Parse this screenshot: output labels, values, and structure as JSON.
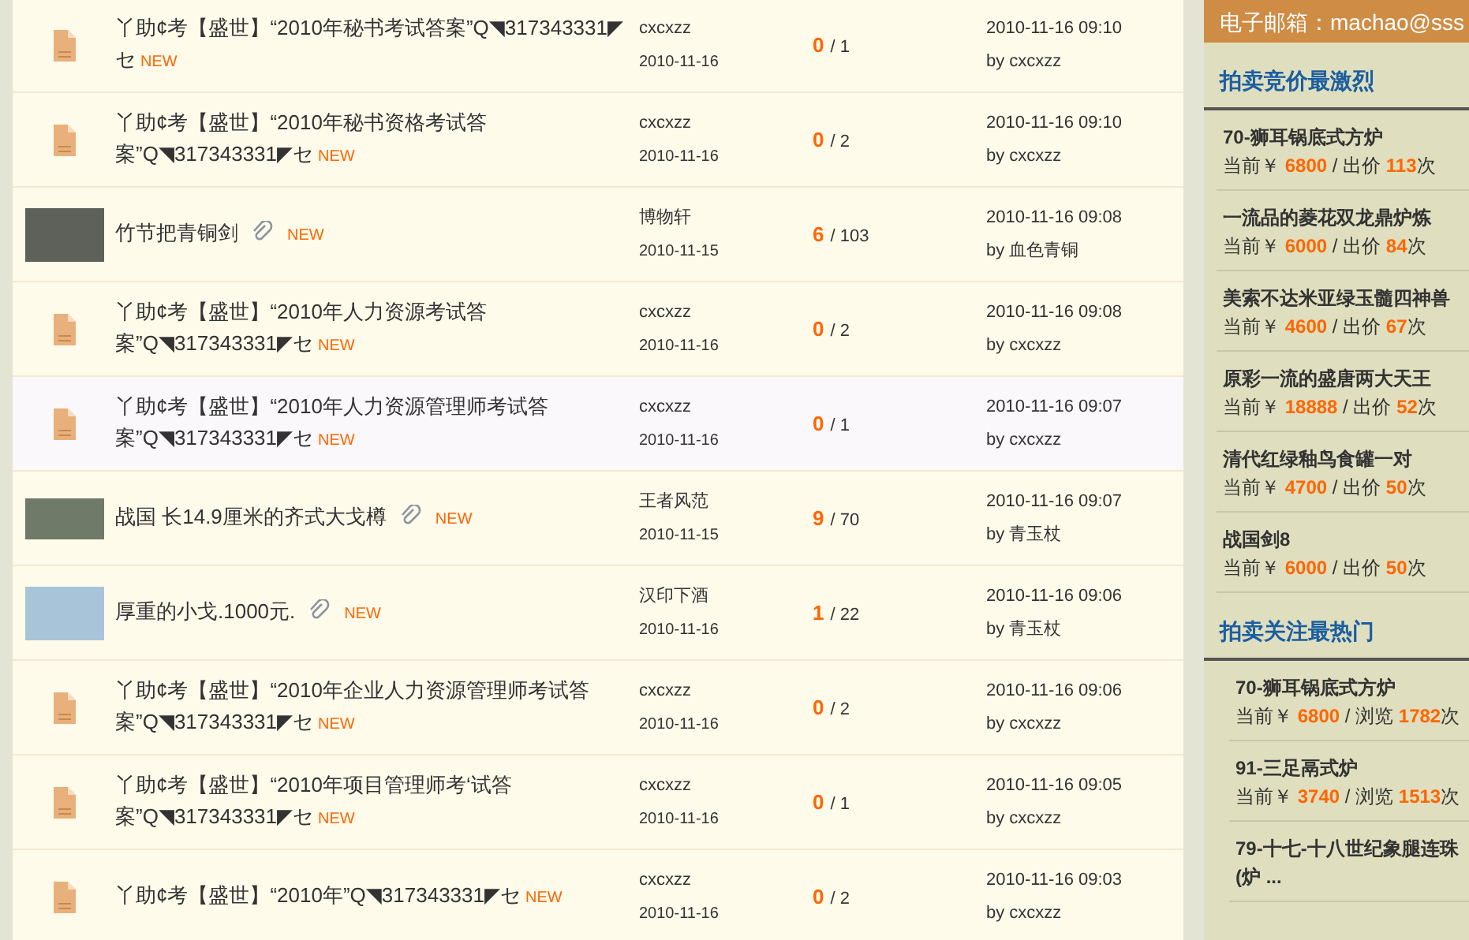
{
  "threads": [
    {
      "kind": "new-icon",
      "title": "丫助¢考【盛世】“2010年秘书考试答案”Q◥317343331◤セ",
      "attachment": false,
      "badge": "NEW",
      "author": "cxcxzz",
      "date": "2010-11-16",
      "replies": "0",
      "views": "/ 1",
      "last_time": "2010-11-16 09:10",
      "last_by": "by cxcxzz",
      "highlighted": false
    },
    {
      "kind": "new-icon",
      "title": "丫助¢考【盛世】“2010年秘书资格考试答案”Q◥317343331◤セ",
      "attachment": false,
      "badge": "NEW",
      "author": "cxcxzz",
      "date": "2010-11-16",
      "replies": "0",
      "views": "/ 2",
      "last_time": "2010-11-16 09:10",
      "last_by": "by cxcxzz",
      "highlighted": false
    },
    {
      "kind": "thumbnail",
      "title": "竹节把青铜剑",
      "attachment": true,
      "badge": "NEW",
      "author": "博物轩",
      "date": "2010-11-15",
      "replies": "6",
      "views": "/ 103",
      "last_time": "2010-11-16 09:08",
      "last_by": "by 血色青铜",
      "highlighted": false
    },
    {
      "kind": "new-icon",
      "title": "丫助¢考【盛世】“2010年人力资源考试答案”Q◥317343331◤セ",
      "attachment": false,
      "badge": "NEW",
      "author": "cxcxzz",
      "date": "2010-11-16",
      "replies": "0",
      "views": "/ 2",
      "last_time": "2010-11-16 09:08",
      "last_by": "by cxcxzz",
      "highlighted": false
    },
    {
      "kind": "new-icon",
      "title": "丫助¢考【盛世】“2010年人力资源管理师考试答案”Q◥317343331◤セ",
      "attachment": false,
      "badge": "NEW",
      "author": "cxcxzz",
      "date": "2010-11-16",
      "replies": "0",
      "views": "/ 1",
      "last_time": "2010-11-16 09:07",
      "last_by": "by cxcxzz",
      "highlighted": true
    },
    {
      "kind": "thumbnail",
      "title": "战国 长14.9厘米的齐式大戈樽",
      "attachment": true,
      "badge": "NEW",
      "author": "王者风范",
      "date": "2010-11-15",
      "replies": "9",
      "views": "/ 70",
      "last_time": "2010-11-16 09:07",
      "last_by": "by 青玉杖",
      "highlighted": false
    },
    {
      "kind": "thumbnail",
      "title": "厚重的小戈.1000元.",
      "attachment": true,
      "badge": "NEW",
      "author": "汉印下酒",
      "date": "2010-11-16",
      "replies": "1",
      "views": "/ 22",
      "last_time": "2010-11-16 09:06",
      "last_by": "by 青玉杖",
      "highlighted": false
    },
    {
      "kind": "new-icon",
      "title": "丫助¢考【盛世】“2010年企业人力资源管理师考试答案”Q◥317343331◤セ",
      "attachment": false,
      "badge": "NEW",
      "author": "cxcxzz",
      "date": "2010-11-16",
      "replies": "0",
      "views": "/ 2",
      "last_time": "2010-11-16 09:06",
      "last_by": "by cxcxzz",
      "highlighted": false
    },
    {
      "kind": "new-icon",
      "title": "丫助¢考【盛世】“2010年项目管理师考‘试答案”Q◥317343331◤セ",
      "attachment": false,
      "badge": "NEW",
      "author": "cxcxzz",
      "date": "2010-11-16",
      "replies": "0",
      "views": "/ 1",
      "last_time": "2010-11-16 09:05",
      "last_by": "by cxcxzz",
      "highlighted": false
    },
    {
      "kind": "new-icon",
      "title": "丫助¢考【盛世】“2010年”Q◥317343331◤セ",
      "attachment": false,
      "badge": "NEW",
      "author": "cxcxzz",
      "date": "2010-11-16",
      "replies": "0",
      "views": "/ 2",
      "last_time": "2010-11-16 09:03",
      "last_by": "by cxcxzz",
      "highlighted": false
    }
  ],
  "sidebar": {
    "contact": "电子邮箱：machao@sss",
    "sections": [
      {
        "kind": "bids",
        "heading": "拍卖竞价最激烈",
        "items": [
          {
            "name": "70-狮耳锅底式方炉",
            "current": "当前￥",
            "price": "6800",
            "sep": "/ 出价",
            "count": "113",
            "unit": "次"
          },
          {
            "name": "一流品的菱花双龙鼎炉炼",
            "current": "当前￥",
            "price": "6000",
            "sep": "/ 出价",
            "count": "84",
            "unit": "次"
          },
          {
            "name": "美索不达米亚绿玉髓四神兽",
            "current": "当前￥",
            "price": "4600",
            "sep": "/ 出价",
            "count": "67",
            "unit": "次"
          },
          {
            "name": "原彩一流的盛唐两大天王",
            "current": "当前￥",
            "price": "18888",
            "sep": "/ 出价",
            "count": "52",
            "unit": "次"
          },
          {
            "name": "清代红绿釉鸟食罐一对",
            "current": "当前￥",
            "price": "4700",
            "sep": "/ 出价",
            "count": "50",
            "unit": "次"
          },
          {
            "name": "战国剑8",
            "current": "当前￥",
            "price": "6000",
            "sep": "/ 出价",
            "count": "50",
            "unit": "次"
          }
        ]
      },
      {
        "kind": "views",
        "heading": "拍卖关注最热门",
        "items": [
          {
            "name": "70-狮耳锅底式方炉",
            "current": "当前￥",
            "price": "6800",
            "sep": "/ 浏览",
            "count": "1782",
            "unit": "次"
          },
          {
            "name": "91-三足鬲式炉",
            "current": "当前￥",
            "price": "3740",
            "sep": "/ 浏览",
            "count": "1513",
            "unit": "次"
          },
          {
            "name": "79-十七-十八世纪象腿连珠(炉 ..."
          }
        ]
      }
    ]
  }
}
